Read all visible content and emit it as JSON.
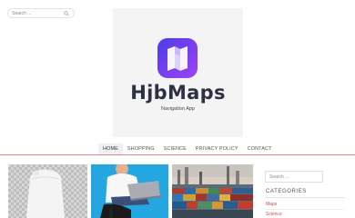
{
  "header": {
    "search": {
      "placeholder": "Search ...",
      "icon": "search-icon"
    },
    "brand": {
      "name": "HjbMaps",
      "tagline": "Navigation App",
      "icon": "folded-map-icon",
      "icon_gradient": [
        "#4b3fe6",
        "#9b46f2"
      ]
    }
  },
  "nav": {
    "items": [
      {
        "label": "HOME",
        "active": true
      },
      {
        "label": "SHOPPING"
      },
      {
        "label": "SCIENCE"
      },
      {
        "label": "PRIVACY POLICY"
      },
      {
        "label": "CONTACT"
      }
    ],
    "underline_color": "#e08a8a"
  },
  "posts": [
    {
      "thumbnail": "white-pouch-package-image"
    },
    {
      "thumbnail": "person-with-laptop-image"
    },
    {
      "thumbnail": "container-port-image"
    }
  ],
  "sidebar": {
    "search_placeholder": "Search ...",
    "categories_title": "CATEGORIES",
    "categories": [
      "Maps",
      "Science"
    ],
    "link_color": "#d24b4b"
  }
}
